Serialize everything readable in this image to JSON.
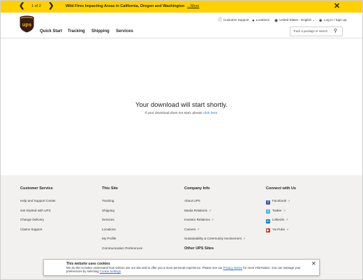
{
  "alert": {
    "prev_icon": "chevron-left-icon",
    "next_icon": "chevron-right-icon",
    "counter": "1 of 2",
    "message": "Wild Fires Impacting Areas in California, Oregon and Washington",
    "more": "...More",
    "close_icon": "close-icon"
  },
  "header": {
    "logo_text": "ups",
    "brand_colors": {
      "brown": "#351c15",
      "gold": "#ffb500",
      "alert_yellow": "#ffd100"
    },
    "utility": [
      {
        "icon": "help-circle-icon",
        "label": "Customer Support"
      },
      {
        "icon": "location-pin-icon",
        "label": "Locations"
      },
      {
        "icon": "globe-icon",
        "label": "United States - English"
      },
      {
        "icon": "user-icon",
        "label": "Log In / Sign Up"
      }
    ],
    "nav": [
      "Quick Start",
      "Tracking",
      "Shipping",
      "Services"
    ],
    "search_placeholder": "Track a package or search",
    "search_icon": "search-icon"
  },
  "main": {
    "headline": "Your download will start shortly.",
    "sub_prefix": "If your download does not start, please ",
    "sub_link": "click here."
  },
  "footer": {
    "columns": [
      {
        "title": "Customer Service",
        "links": [
          "Help and Support Center",
          "Get Started with UPS",
          "Change Delivery",
          "Claims Support"
        ]
      },
      {
        "title": "This Site",
        "links": [
          "Tracking",
          "Shipping",
          "Services",
          "Locations",
          "My Profile",
          "Communication Preferences"
        ]
      },
      {
        "title": "Company Info",
        "links": [
          "About UPS",
          "Media Relations",
          "Investor Relations",
          "Careers",
          "Sustainability & Community Involvement"
        ]
      },
      {
        "title": "Connect with Us",
        "links": [
          "Facebook",
          "Twitter",
          "LinkedIn",
          "YouTube"
        ]
      }
    ],
    "other_title": "Other UPS Sites"
  },
  "cookie": {
    "title": "This website uses cookies",
    "text1": "We do this to better understand how visitors use our site and to offer you a more personal experience. Please see our ",
    "privacy_link": "Privacy Notice",
    "text2": " for more information. You can manage your preferences by selecting ",
    "settings_link": "Cookie Settings",
    "text3": ".",
    "close_icon": "close-icon"
  }
}
